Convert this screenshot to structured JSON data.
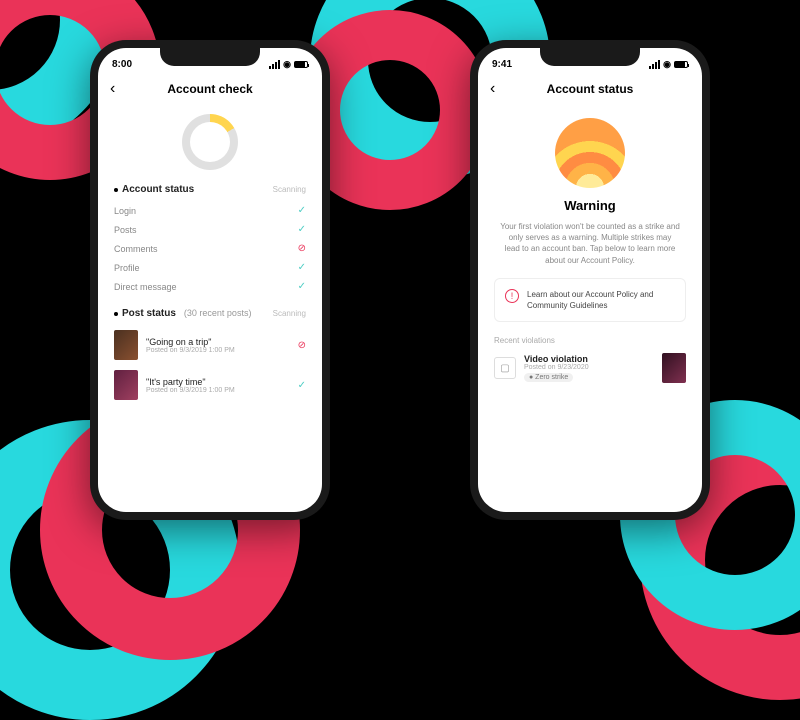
{
  "left": {
    "time": "8:00",
    "title": "Account check",
    "account_section": {
      "label": "Account status",
      "status": "Scanning"
    },
    "items": [
      {
        "label": "Login",
        "ok": true
      },
      {
        "label": "Posts",
        "ok": true
      },
      {
        "label": "Comments",
        "ok": false
      },
      {
        "label": "Profile",
        "ok": true
      },
      {
        "label": "Direct message",
        "ok": true
      }
    ],
    "post_section": {
      "label": "Post status",
      "sub": "(30 recent posts)",
      "status": "Scanning"
    },
    "posts": [
      {
        "title": "\"Going on a trip\"",
        "meta": "Posted on 9/3/2019 1:00 PM",
        "ok": false
      },
      {
        "title": "\"It's party time\"",
        "meta": "Posted on 9/3/2019 1:00 PM",
        "ok": true
      }
    ]
  },
  "right": {
    "time": "9:41",
    "title": "Account status",
    "warning_title": "Warning",
    "warning_body": "Your first violation won't be counted as a strike and only serves as a warning. Multiple strikes may lead to an account ban. Tap below to learn more about our Account Policy.",
    "policy_text": "Learn about our Account Policy and Community Guidelines",
    "recent_label": "Recent violations",
    "violation": {
      "title": "Video violation",
      "meta": "Posted on 9/23/2020",
      "badge": "● Zero strike"
    }
  }
}
